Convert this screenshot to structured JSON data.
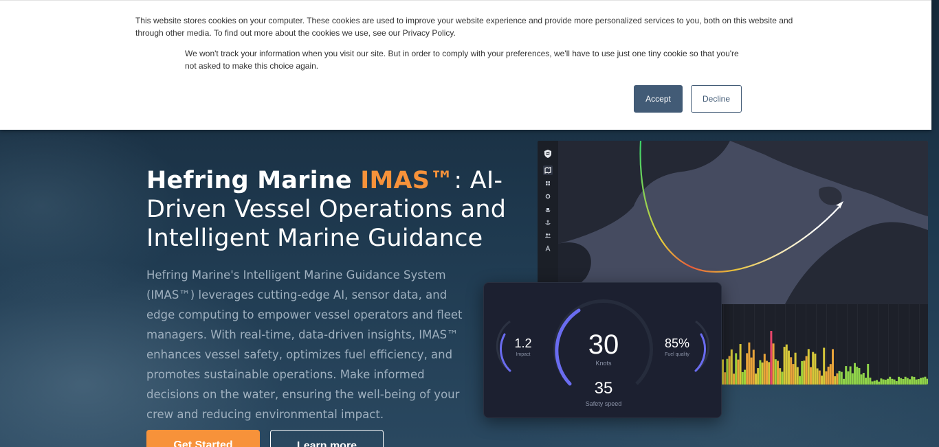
{
  "cookie_banner": {
    "text_primary": "This website stores cookies on your computer. These cookies are used to improve your website experience and provide more personalized services to you, both on this website and through other media. To find out more about the cookies we use, see our Privacy Policy.",
    "text_secondary": "We won't track your information when you visit our site. But in order to comply with your preferences, we'll have to use just one tiny cookie so that you're not asked to make this choice again.",
    "accept_label": "Accept",
    "decline_label": "Decline"
  },
  "hero": {
    "title_brand": "Hefring Marine ",
    "title_accent": "IMAS™",
    "title_rest": ": AI-Driven Vessel Operations and Intelligent Marine Guidance",
    "description": "Hefring Marine's Intelligent Marine Guidance System (IMAS™) leverages cutting-edge AI, sensor data, and edge computing to empower vessel operators and fleet managers. With real-time, data-driven insights, IMAS™ enhances vessel safety, optimizes fuel efficiency, and promotes sustainable operations. Make informed decisions on the water, ensuring the well-being of your crew and reducing environmental impact.",
    "primary_button": "Get Started",
    "secondary_button": "Learn more"
  },
  "dashboard": {
    "impact_value": "1.2",
    "impact_label": "Impact",
    "speed_value": "30",
    "speed_label": "Knots",
    "fuel_value": "85%",
    "fuel_label": "Fuel quality",
    "safety_value": "35",
    "safety_label": "Safety speed"
  },
  "colors": {
    "accent_orange": "#f7923a",
    "accept_button": "#425b76",
    "gauge_blue": "#6a6cf0"
  },
  "icons": [
    "shield-logo-icon",
    "map-icon",
    "dashboard-icon",
    "settings-icon",
    "vessel-icon",
    "anchor-icon",
    "users-icon",
    "font-icon"
  ]
}
